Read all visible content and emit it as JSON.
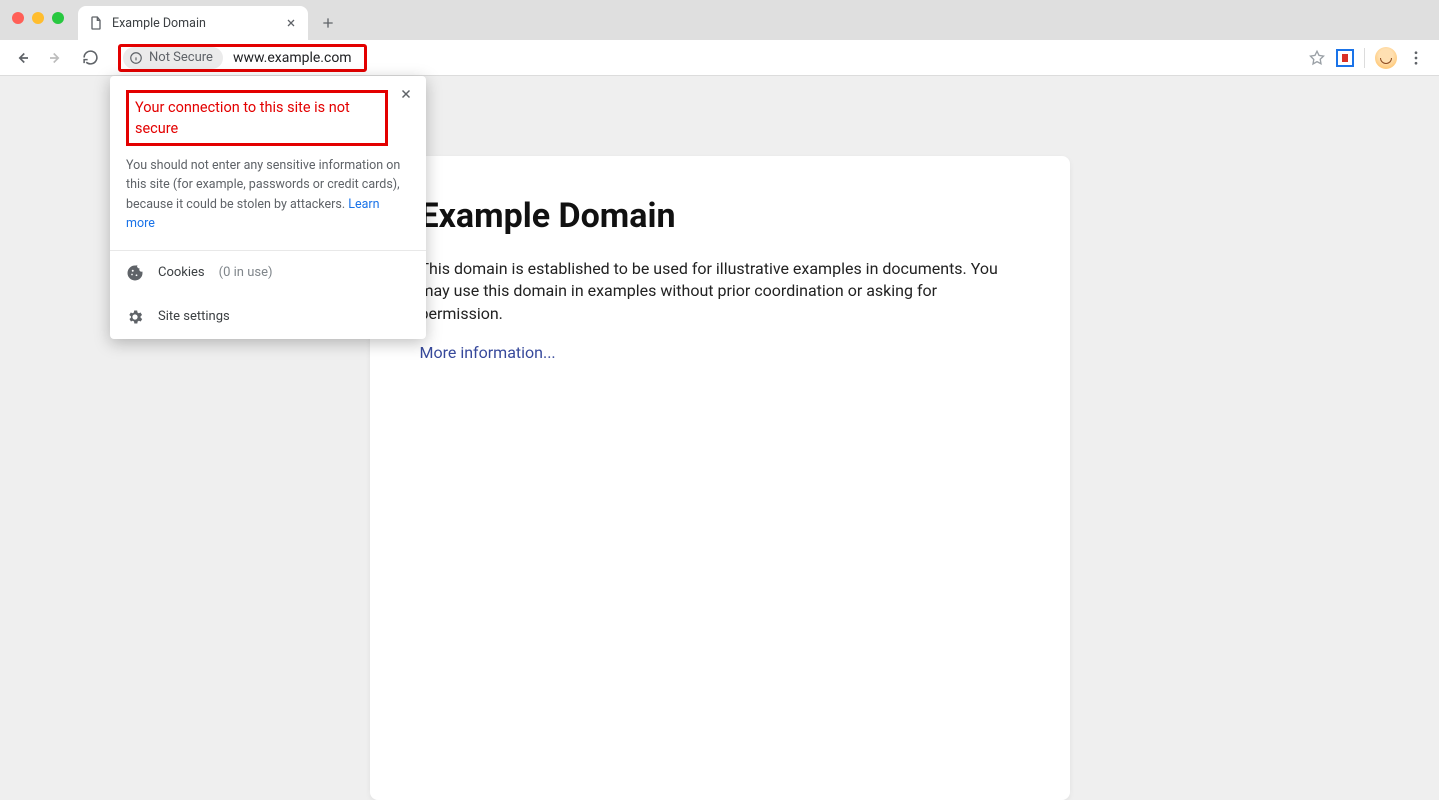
{
  "tab": {
    "title": "Example Domain"
  },
  "omnibox": {
    "security_label": "Not Secure",
    "url": "www.example.com"
  },
  "security_popup": {
    "title": "Your connection to this site is not secure",
    "description": "You should not enter any sensitive information on this site (for example, passwords or credit cards), because it could be stolen by attackers. ",
    "learn_more": "Learn more",
    "cookies_label": "Cookies",
    "cookies_count": "(0 in use)",
    "site_settings": "Site settings"
  },
  "page": {
    "heading": "Example Domain",
    "paragraph": "This domain is established to be used for illustrative examples in documents. You may use this domain in examples without prior coordination or asking for permission.",
    "link": "More information..."
  }
}
